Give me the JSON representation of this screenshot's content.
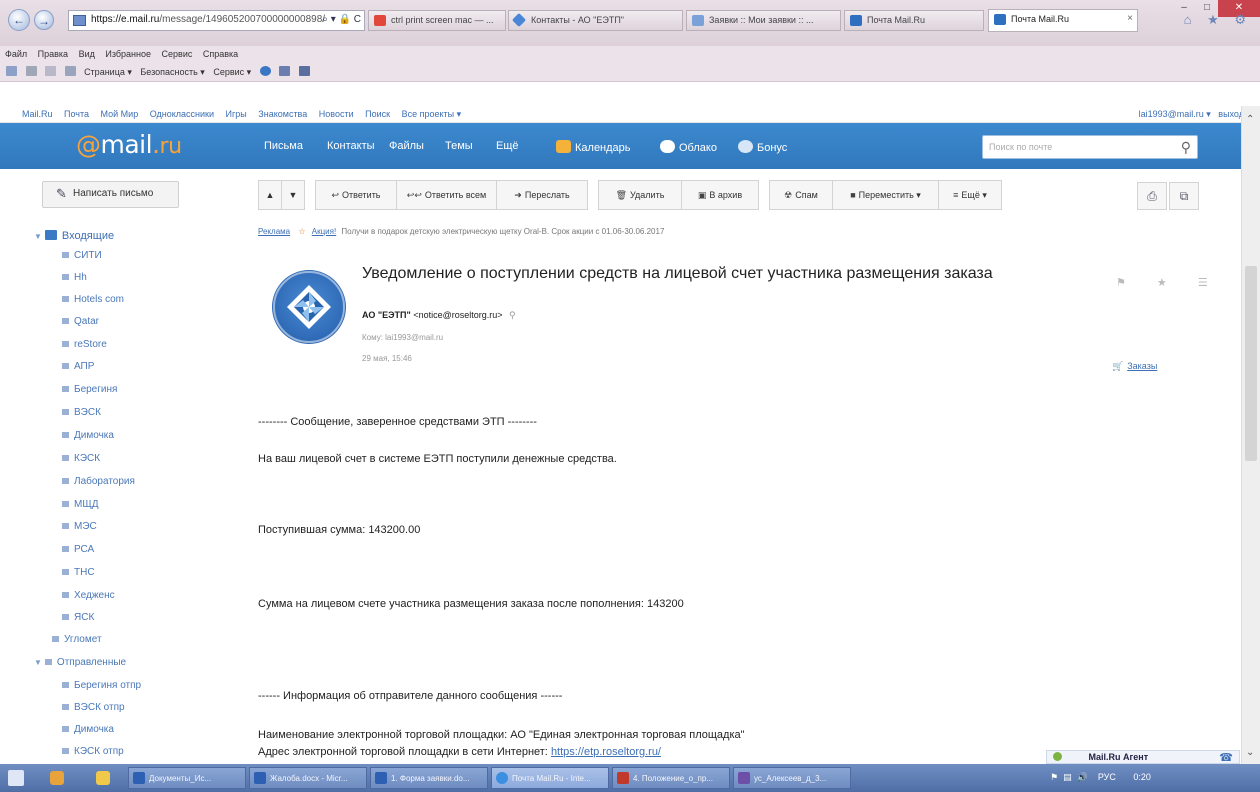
{
  "browser": {
    "url": "https://e.mail.ru/message/149605200700000000898/",
    "url_host": "https://e.mail.ru",
    "url_path": "/message/149605200700000000898/",
    "url_tools": "⌕ ▾ 🔒 C",
    "tabs": [
      {
        "label": "ctrl print screen mac — ...",
        "color": "#e2473c"
      },
      {
        "label": "Контакты - АО \"ЕЭТП\"",
        "color": "#4a86d8"
      },
      {
        "label": "Заявки :: Мои заявки :: ...",
        "color": "#7aa2d9"
      },
      {
        "label": "Почта Mail.Ru",
        "color": "#2e6fc0"
      },
      {
        "label": "Почта Mail.Ru",
        "color": "#2e6fc0"
      }
    ],
    "tab_close": "×",
    "window_controls": {
      "minimize": "–",
      "maximize": "□",
      "close": "✕"
    },
    "fav_icons": "⌂ ★ ⚙",
    "menu": [
      "Файл",
      "Правка",
      "Вид",
      "Избранное",
      "Сервис",
      "Справка"
    ],
    "commands": [
      "Страница ▾",
      "Безопасность ▾",
      "Сервис ▾"
    ]
  },
  "portal": {
    "links": [
      "Mail.Ru",
      "Почта",
      "Мой Мир",
      "Одноклассники",
      "Игры",
      "Знакомства",
      "Новости",
      "Поиск",
      "Все проекты ▾"
    ],
    "user": "lai1993@mail.ru ▾",
    "logout": "выход"
  },
  "header": {
    "logo_at": "@",
    "logo_mail": "mail",
    "logo_dot": ".",
    "logo_ru": "ru",
    "nav": {
      "letters": "Письма",
      "contacts": "Контакты",
      "files": "Файлы",
      "themes": "Темы",
      "more": "Ещё",
      "calendar": "Календарь",
      "cloud": "Облако",
      "bonus": "Бонус"
    },
    "search_placeholder": "Поиск по почте"
  },
  "sidebar": {
    "compose_label": "Написать письмо",
    "inbox_label": "Входящие",
    "inbox_folders": [
      "СИТИ",
      "Hh",
      "Hotels com",
      "Qatar",
      "reStore",
      "АПР",
      "Берегиня",
      "ВЭСК",
      "Димочка",
      "КЭСК",
      "Лаборатория",
      "МЩД",
      "МЭС",
      "РСА",
      "ТНС",
      "Хедженс",
      "ЯСК"
    ],
    "top_folder": "Угломет",
    "sent_label": "Отправленные",
    "sent_folders": [
      "Берегиня отпр",
      "ВЭСК отпр",
      "Димочка",
      "КЭСК отпр"
    ]
  },
  "toolbar": {
    "up": "▲",
    "down": "▼",
    "reply": "Ответить",
    "reply_all": "Ответить всем",
    "forward": "Переслать",
    "delete": "Удалить",
    "archive": "В архив",
    "spam": "Спам",
    "move": "Переместить ▾",
    "more": "Ещё ▾",
    "print_icon": "⎙",
    "expand_icon": "⧉"
  },
  "ad": {
    "label": "Реклама",
    "icon": "☆",
    "action": "Акция!",
    "text": "Получи в подарок детскую электрическую щетку Oral-B. Срок акции с 01.06-30.06.2017"
  },
  "message": {
    "subject": "Уведомление о поступлении средств на лицевой счет участника размещения заказа",
    "from_name": "АО \"ЕЭТП\"",
    "from_email": "<notice@roseltorg.ru>",
    "to": "Кому: lai1993@mail.ru",
    "date": "29 мая, 15:46",
    "orders": "Заказы",
    "actions": "⚑ ★ ☰"
  },
  "body": {
    "line1": "-------- Сообщение, заверенное средствами ЭТП --------",
    "line2": "На ваш лицевой счет в системе ЕЭТП поступили денежные средства.",
    "line3": "Поступившая сумма: 143200.00",
    "line4": "Сумма на лицевом счете участника размещения заказа после пополнения: 143200",
    "line5": "------ Информация об отправителе данного сообщения ------",
    "line6": "Наименование электронной торговой площадки: АО \"Единая электронная торговая площадка\"",
    "line7_prefix": "Адрес электронной торговой площадки в сети Интернет: ",
    "line7_link": "https://etp.roseltorg.ru/"
  },
  "agent": {
    "label": "Mail.Ru Агент",
    "phone_icon": "☎"
  },
  "taskbar": {
    "tasks": [
      {
        "label": "Документы_Ис...",
        "color": "#2d5fb3"
      },
      {
        "label": "Жалоба.docx - Micr...",
        "color": "#2d5fb3"
      },
      {
        "label": "1. Форма заявки.do...",
        "color": "#2d5fb3"
      },
      {
        "label": "Почта Mail.Ru - Inte...",
        "color": "#3b8fe0"
      },
      {
        "label": "4. Положение_о_пр...",
        "color": "#c0392b"
      },
      {
        "label": "ус_Алексеев_д_3...",
        "color": "#6d4fa8"
      }
    ],
    "lang": "РУС",
    "time": "0:20"
  }
}
